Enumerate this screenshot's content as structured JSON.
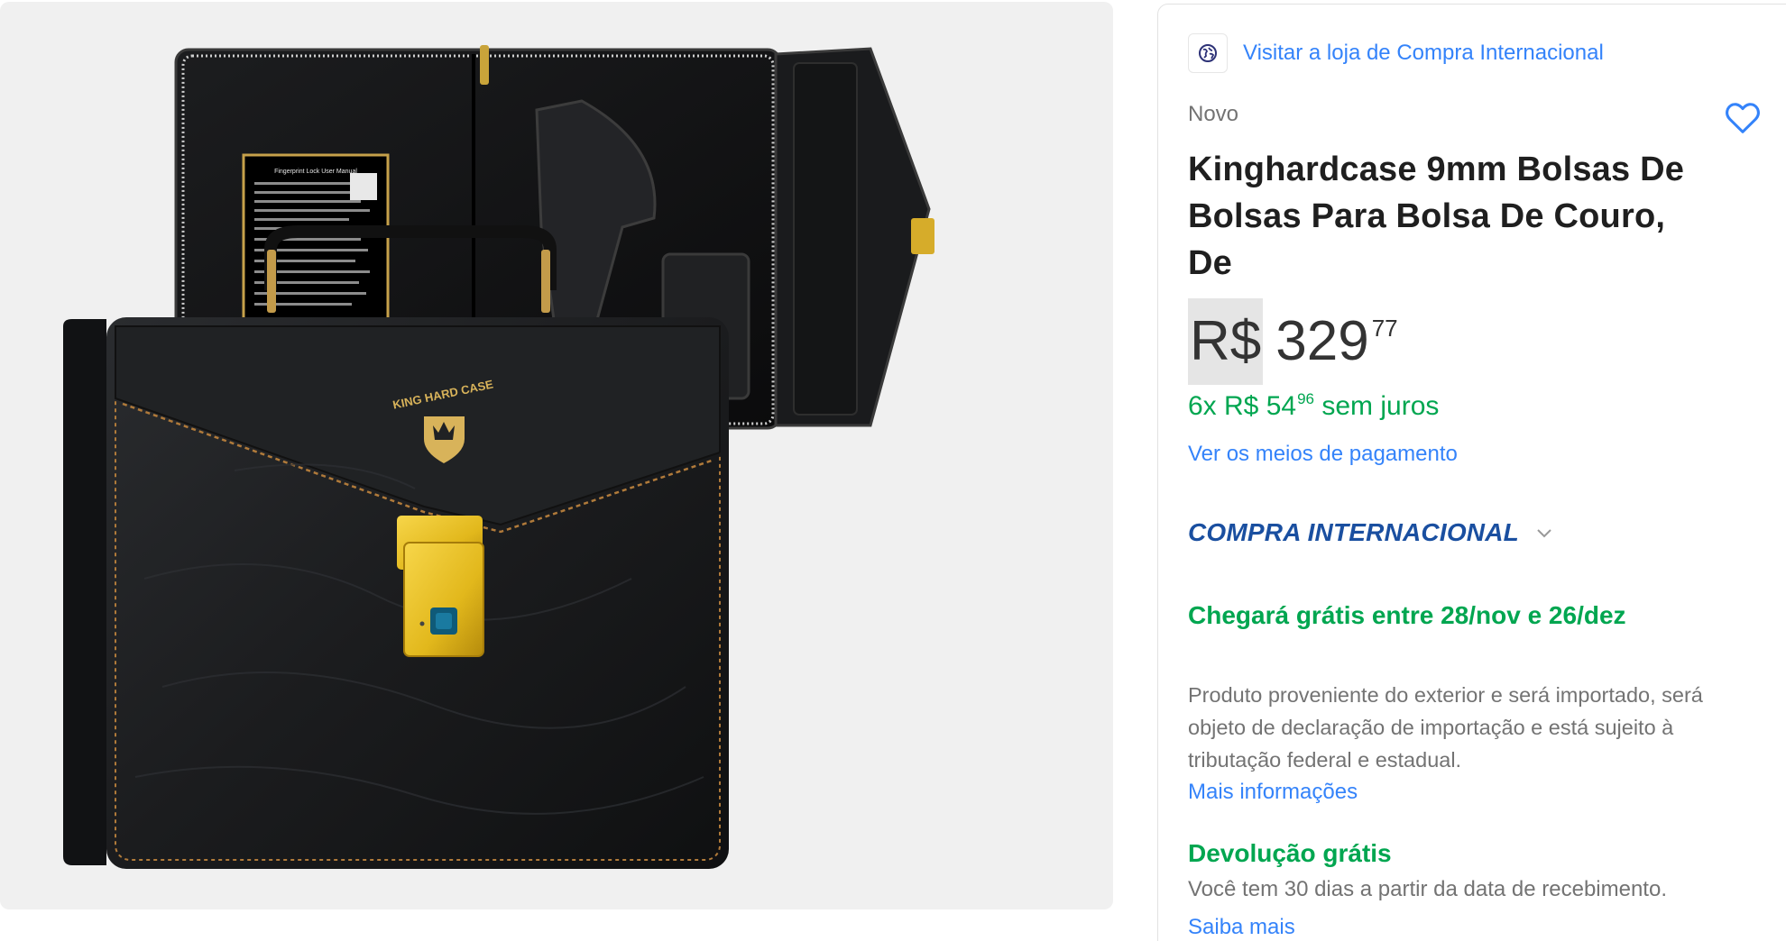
{
  "store": {
    "logo_icon": "globe-icon",
    "link_label": "Visitar a loja de Compra Internacional"
  },
  "product": {
    "condition": "Novo",
    "title": "Kinghardcase 9mm Bolsas De Bolsas Para Bolsa De Couro, De",
    "image_alt": "Bolsa de couro preta com fechadura biométrica dourada",
    "brand_mark": "KING HARD CASE",
    "manual_heading": "Fingerprint Lock User Manual",
    "favorite_icon": "heart-icon"
  },
  "price": {
    "currency": "R$",
    "integer": "329",
    "cents": "77",
    "installments_prefix": "6x R$ 54",
    "installments_cents": "96",
    "installments_suffix": "sem juros",
    "payment_link": "Ver os meios de pagamento"
  },
  "international": {
    "label": "COMPRA INTERNACIONAL",
    "chevron_icon": "chevron-down-icon"
  },
  "shipping": {
    "text": "Chegará grátis entre 28/nov e 26/dez"
  },
  "import_notice": {
    "text": "Produto proveniente do exterior e será importado, será objeto de declaração de importação e está sujeito à tributação federal e estadual.",
    "link": "Mais informações"
  },
  "returns": {
    "title": "Devolução grátis",
    "text": "Você tem 30 dias a partir da data de recebimento.",
    "link": "Saiba mais"
  },
  "colors": {
    "accent_blue": "#3483fa",
    "success_green": "#00a650",
    "international_blue": "#1a4fa0",
    "gallery_bg": "#f0f0f0"
  }
}
